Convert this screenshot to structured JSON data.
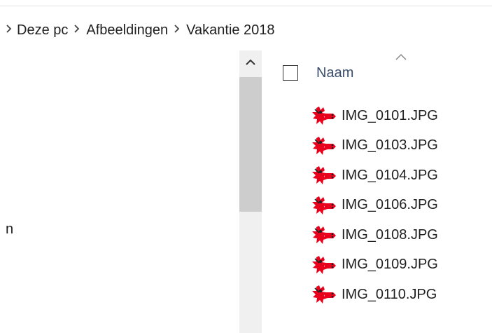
{
  "breadcrumb": {
    "items": [
      {
        "label": "Deze pc"
      },
      {
        "label": "Afbeeldingen"
      },
      {
        "label": "Vakantie 2018"
      }
    ],
    "separator": ">"
  },
  "navigation_pane": {
    "partial_text": "n"
  },
  "file_list": {
    "column_header": "Naam",
    "sort_direction": "ascending",
    "icon": "red-image-file-icon",
    "accent_color": "#e8001c",
    "files": [
      {
        "name": "IMG_0101.JPG"
      },
      {
        "name": "IMG_0103.JPG"
      },
      {
        "name": "IMG_0104.JPG"
      },
      {
        "name": "IMG_0106.JPG"
      },
      {
        "name": "IMG_0108.JPG"
      },
      {
        "name": "IMG_0109.JPG"
      },
      {
        "name": "IMG_0110.JPG"
      }
    ]
  }
}
